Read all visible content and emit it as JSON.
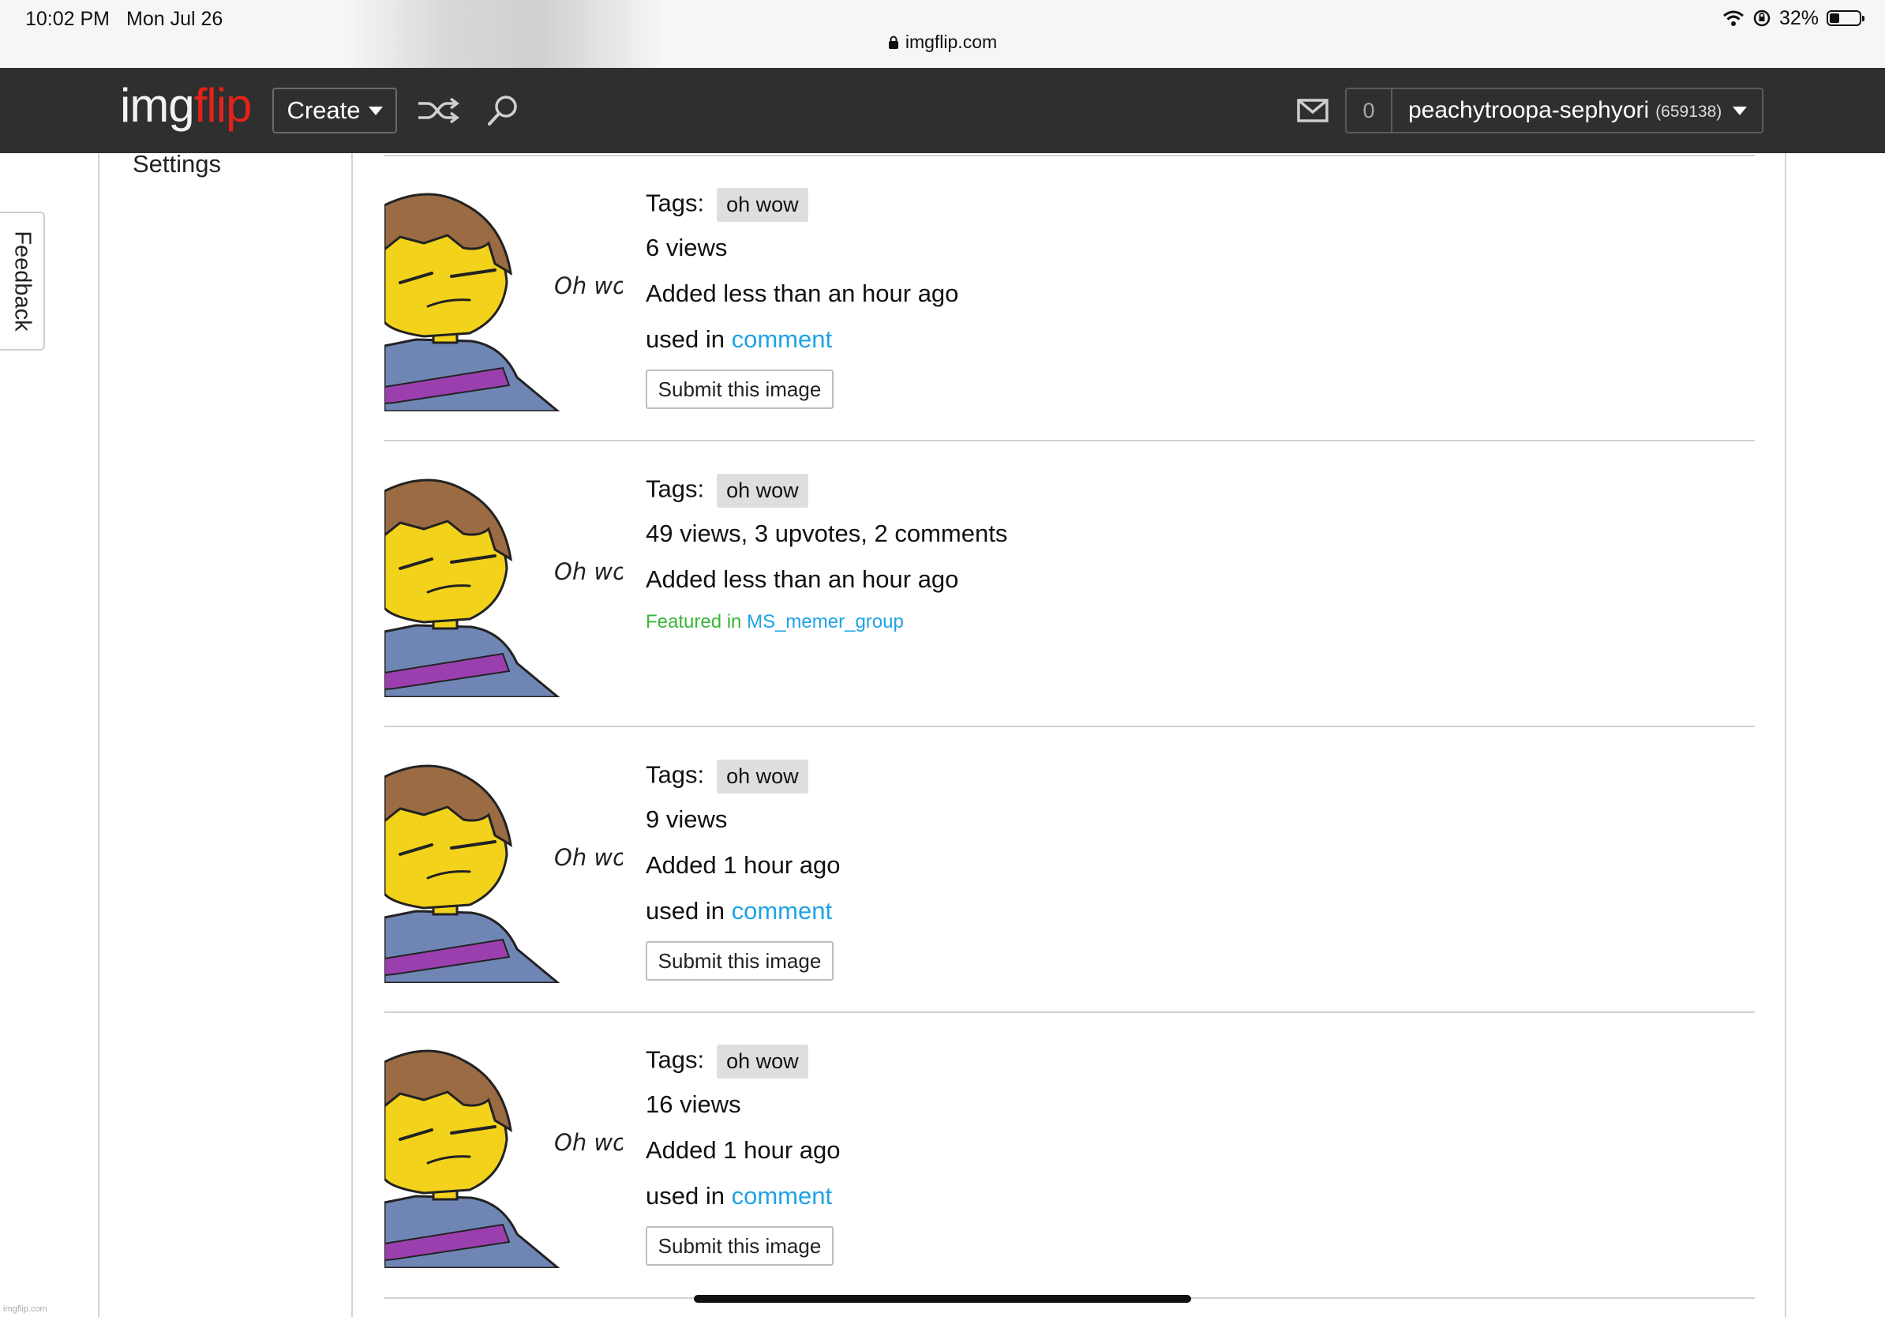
{
  "status_bar": {
    "time": "10:02 PM",
    "date": "Mon Jul 26",
    "url": "imgflip.com",
    "battery": "32%",
    "battery_level": 0.32
  },
  "header": {
    "logo_part1": "img",
    "logo_part2": "flip",
    "create_label": "Create",
    "notification_count": "0",
    "username": "peachytroopa-sephyori",
    "points": "(659138)"
  },
  "sidebar": {
    "settings_label": "Settings"
  },
  "feedback_label": "Feedback",
  "footer_small": "imgflip.com",
  "colors": {
    "header_bg": "#2f2f2f",
    "logo_accent": "#e2231a",
    "link": "#1fa3e5",
    "featured": "#3ab53a"
  },
  "images": [
    {
      "caption": "Oh wo",
      "tags_label": "Tags:",
      "tag": "oh wow",
      "stats": "6 views",
      "added": "Added less than an hour ago",
      "used_in_label": "used in",
      "used_in_link": "comment",
      "submit_label": "Submit this image"
    },
    {
      "caption": "Oh wo",
      "tags_label": "Tags:",
      "tag": "oh wow",
      "stats": "49 views, 3 upvotes, 2 comments",
      "added": "Added less than an hour ago",
      "featured_label": "Featured in",
      "featured_link": "MS_memer_group"
    },
    {
      "caption": "Oh wo",
      "tags_label": "Tags:",
      "tag": "oh wow",
      "stats": "9 views",
      "added": "Added 1 hour ago",
      "used_in_label": "used in",
      "used_in_link": "comment",
      "submit_label": "Submit this image"
    },
    {
      "caption": "Oh wo",
      "tags_label": "Tags:",
      "tag": "oh wow",
      "stats": "16 views",
      "added": "Added 1 hour ago",
      "used_in_label": "used in",
      "used_in_link": "comment",
      "submit_label": "Submit this image"
    }
  ]
}
